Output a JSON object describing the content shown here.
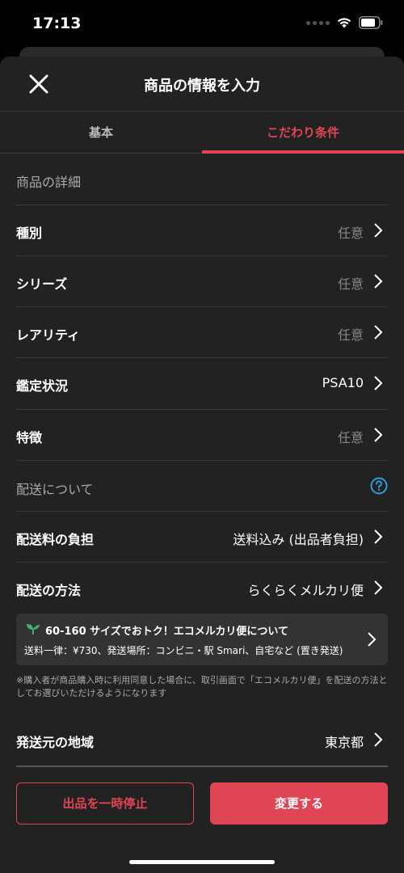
{
  "status": {
    "time": "17:13"
  },
  "header": {
    "title": "商品の情報を入力",
    "close_icon": "close-icon"
  },
  "tabs": [
    {
      "label": "基本"
    },
    {
      "label": "こだわり条件",
      "active": true
    }
  ],
  "details": {
    "section_label": "商品の詳細",
    "rows": [
      {
        "label": "種別",
        "value": "任意"
      },
      {
        "label": "シリーズ",
        "value": "任意"
      },
      {
        "label": "レアリティ",
        "value": "任意"
      },
      {
        "label": "鑑定状況",
        "value": "PSA10"
      },
      {
        "label": "特徴",
        "value": "任意"
      }
    ]
  },
  "shipping": {
    "section_label": "配送について",
    "rows": [
      {
        "label": "配送料の負担",
        "value": "送料込み (出品者負担)"
      },
      {
        "label": "配送の方法",
        "value": "らくらくメルカリ便"
      }
    ],
    "eco_card": {
      "title": "60-160 サイズでおトク！エコメルカリ便について",
      "subtitle": "送料一律：¥730、発送場所：コンビニ・駅 Smari、自宅など (置き発送)"
    },
    "note": "※購入者が商品購入時に利用同意した場合に、取引画面で「エコメルカリ便」を配送の方法としてお選びいただけるようになります",
    "origin_row": {
      "label": "発送元の地域",
      "value": "東京都"
    }
  },
  "footer": {
    "pause_label": "出品を一時停止",
    "change_label": "変更する"
  },
  "colors": {
    "accent": "#e04555",
    "background": "#222222",
    "help": "#2d9cdb"
  }
}
